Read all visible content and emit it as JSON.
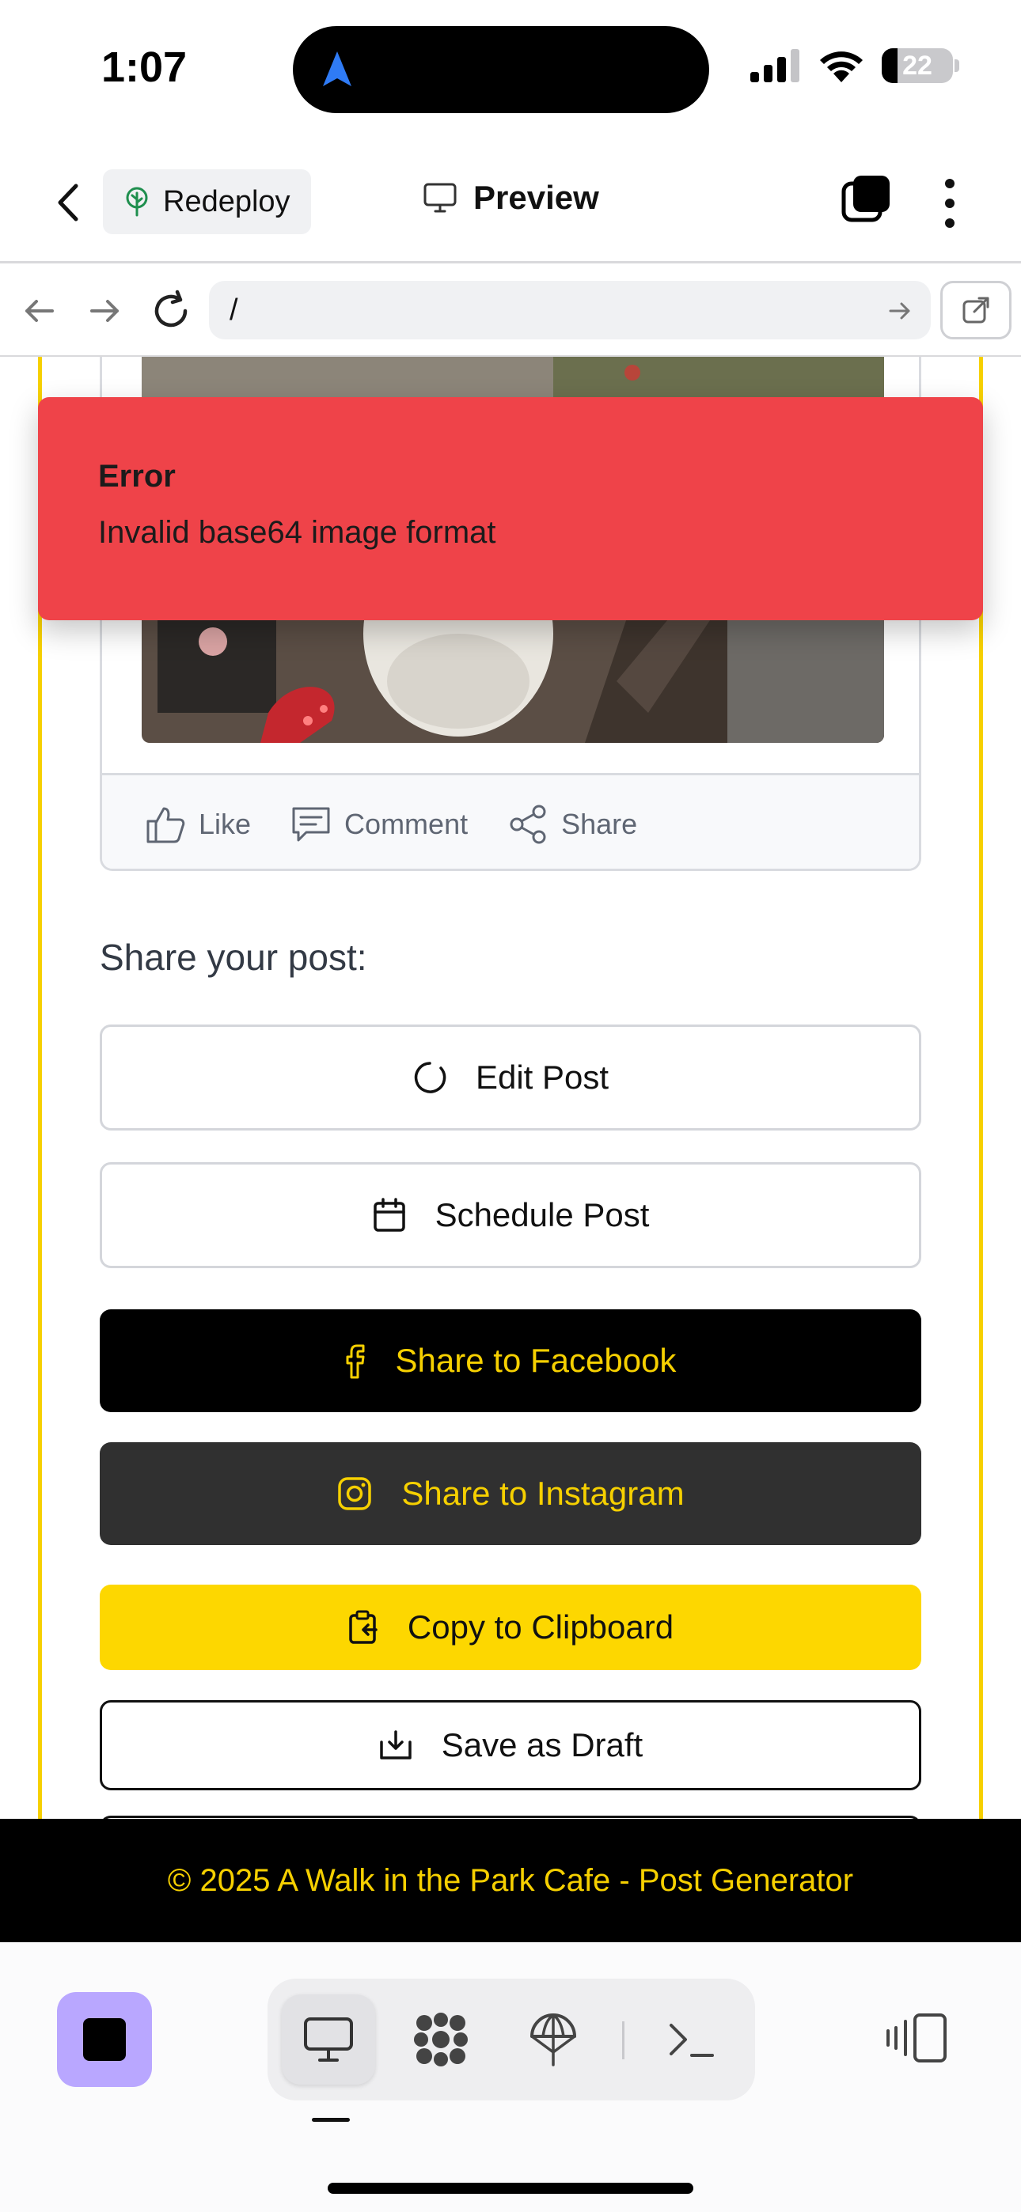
{
  "status": {
    "time": "1:07",
    "battery": "22"
  },
  "header": {
    "redeploy_label": "Redeploy",
    "title": "Preview"
  },
  "urlbar": {
    "url": "/"
  },
  "post": {
    "actions": {
      "like": "Like",
      "comment": "Comment",
      "share": "Share"
    }
  },
  "share": {
    "heading": "Share your post:",
    "edit_label": "Edit Post",
    "schedule_label": "Schedule Post",
    "facebook_label": "Share to Facebook",
    "instagram_label": "Share to Instagram",
    "clipboard_label": "Copy to Clipboard",
    "draft_label": "Save as Draft"
  },
  "toast": {
    "title": "Error",
    "message": "Invalid base64 image format"
  },
  "footer": {
    "text": "© 2025 A Walk in the Park Cafe - Post Generator"
  },
  "colors": {
    "brand_yellow": "#f6d000",
    "error_red": "#ef4349",
    "stop_purple": "#b9a7ff"
  },
  "icons": [
    "navigation-arrow-icon",
    "cellular-signal-icon",
    "wifi-icon",
    "battery-icon",
    "chevron-left-icon",
    "tree-icon",
    "monitor-icon",
    "tabs-icon",
    "more-vertical-icon",
    "arrow-left-icon",
    "arrow-right-icon",
    "reload-icon",
    "external-link-icon",
    "thumbs-up-icon",
    "comment-icon",
    "share-icon",
    "loading-spinner-icon",
    "calendar-icon",
    "facebook-icon",
    "instagram-icon",
    "clipboard-icon",
    "download-icon",
    "stop-icon",
    "dots-grid-icon",
    "parachute-icon",
    "terminal-icon",
    "side-panel-icon"
  ]
}
